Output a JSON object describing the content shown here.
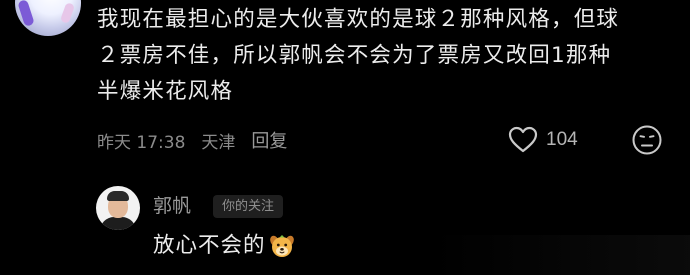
{
  "comment": {
    "lines": [
      "我现在最担心的是大伙喜欢的是球２那种风格，但球",
      "２票房不佳，所以郭帆会不会为了票房又改回1那种",
      "半爆米花风格"
    ],
    "time": "昨天 17:38",
    "location": "天津",
    "reply_label": "回复",
    "like_count": "104",
    "icons": {
      "like": "heart-icon",
      "dislike": "dislike-face-icon"
    }
  },
  "reply": {
    "author": "郭帆",
    "badge": "你的关注",
    "text": "放心不会的",
    "emoji": "dog-face-emoji"
  },
  "colors": {
    "background": "#000000",
    "text": "#ececec",
    "meta": "#8b8b8b",
    "badge_bg": "#1f1f1f"
  }
}
